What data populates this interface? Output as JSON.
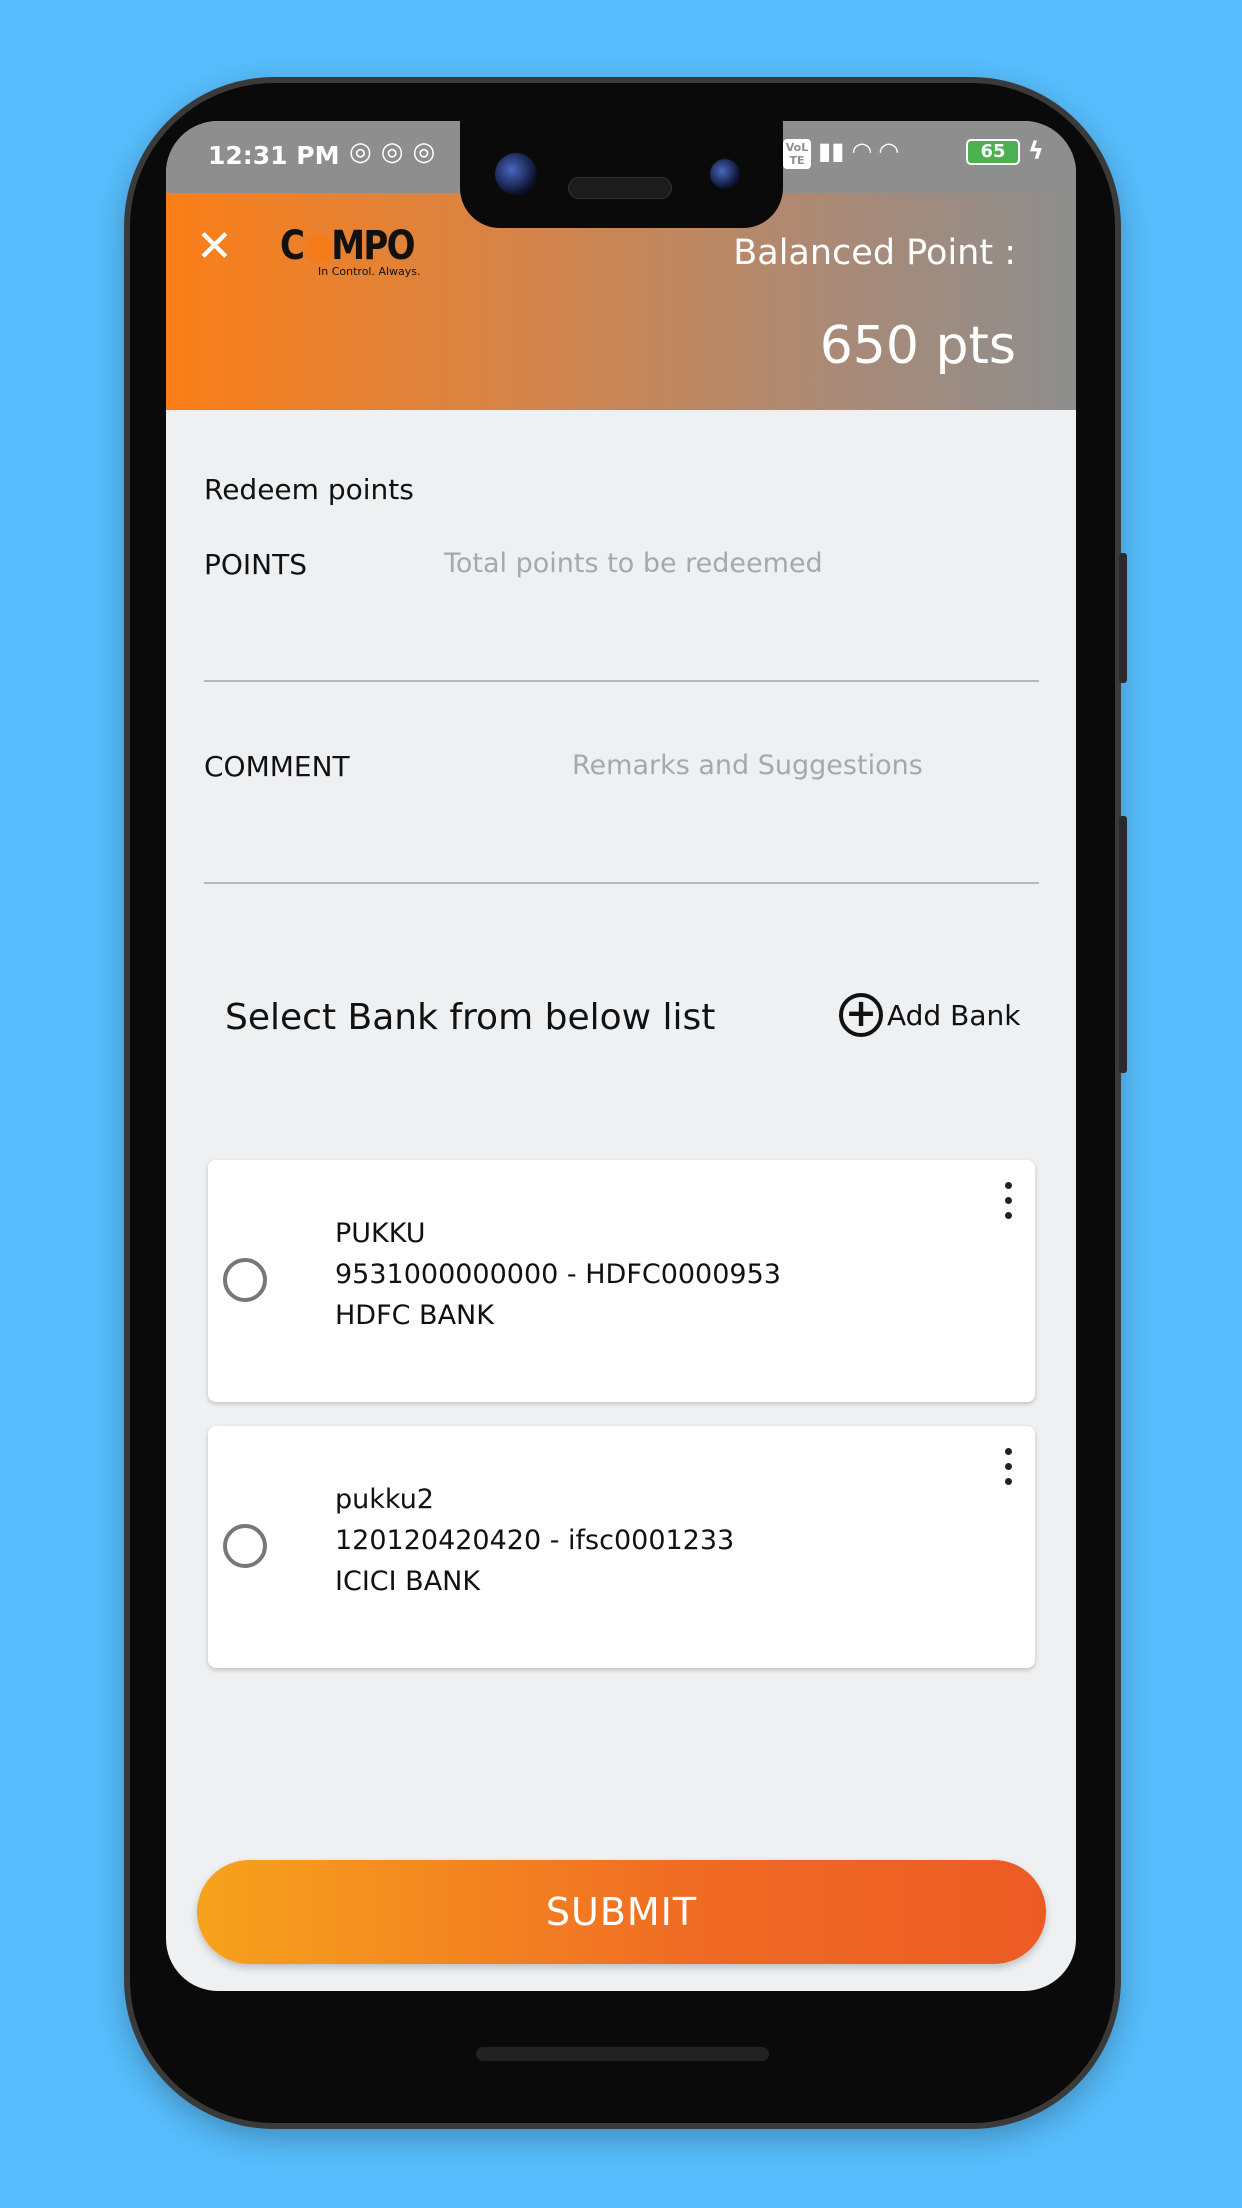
{
  "status_bar": {
    "time": "12:31 PM",
    "battery": "65",
    "network": "VoLTE"
  },
  "header": {
    "logo_text": "COMPO",
    "logo_tagline": "In Control. Always.",
    "balance_label": "Balanced Point :",
    "balance_value": "650 pts"
  },
  "form": {
    "title": "Redeem points",
    "points_label": "POINTS",
    "points_placeholder": "Total points to be redeemed",
    "points_value": "",
    "comment_label": "COMMENT",
    "comment_placeholder": "Remarks and Suggestions",
    "comment_value": ""
  },
  "banks": {
    "heading": "Select Bank from below list",
    "add_label": "Add Bank",
    "items": [
      {
        "name": "PUKKU",
        "account": "9531000000000 - HDFC0000953",
        "bank": "HDFC BANK",
        "selected": false
      },
      {
        "name": "pukku2",
        "account": "120120420420 - ifsc0001233",
        "bank": "ICICI BANK",
        "selected": false
      }
    ]
  },
  "submit_label": "SUBMIT",
  "colors": {
    "accent": "#fb7e17",
    "background": "#57bdfc"
  }
}
